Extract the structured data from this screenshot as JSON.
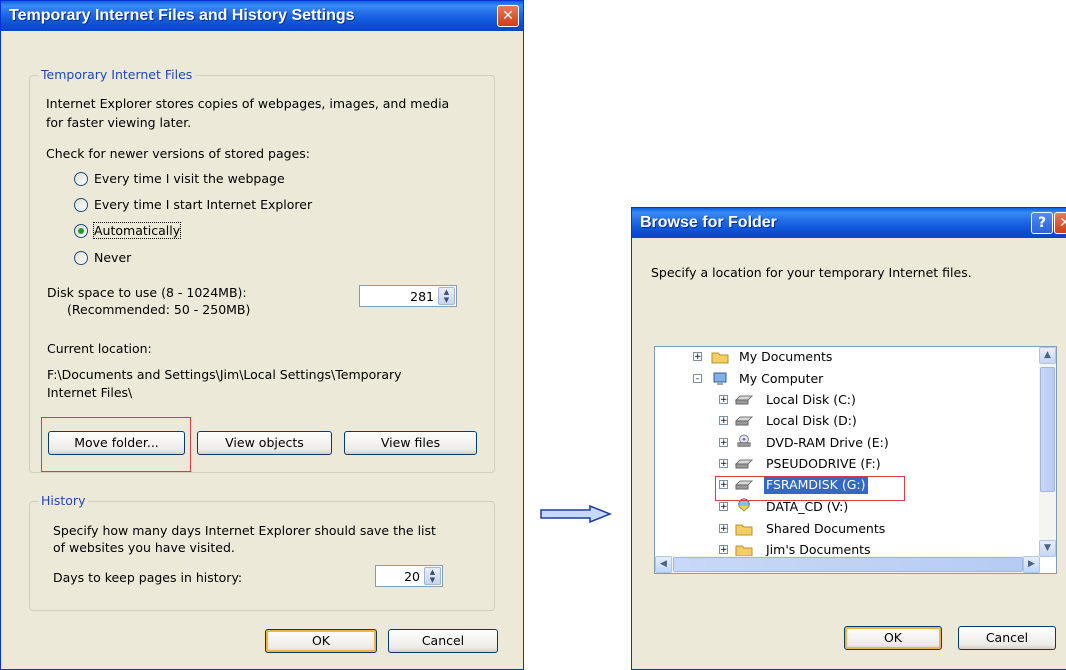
{
  "settings": {
    "title": "Temporary Internet Files and History Settings",
    "tif_legend": "Temporary Internet Files",
    "desc_line1": "Internet Explorer stores copies of webpages, images, and media",
    "desc_line2": "for faster viewing later.",
    "check_label": "Check for newer versions of stored pages:",
    "radios": [
      {
        "label": "Every time I visit the webpage",
        "selected": false
      },
      {
        "label": "Every time I start Internet Explorer",
        "selected": false
      },
      {
        "label": "Automatically",
        "selected": true
      },
      {
        "label": "Never",
        "selected": false
      }
    ],
    "disk_label": "Disk space to use (8 - 1024MB):",
    "disk_rec": "(Recommended: 50 - 250MB)",
    "disk_value": "281",
    "current_label": "Current location:",
    "path_line1": "F:\\Documents and Settings\\Jim\\Local Settings\\Temporary",
    "path_line2": "Internet Files\\",
    "btn_move": "Move folder...",
    "btn_objects": "View objects",
    "btn_files": "View files",
    "history_legend": "History",
    "hist_line1": "Specify how many days Internet Explorer should save the list",
    "hist_line2": "of websites you have visited.",
    "days_label": "Days to keep pages in history:",
    "days_value": "20",
    "ok": "OK",
    "cancel": "Cancel"
  },
  "browse": {
    "title": "Browse for Folder",
    "help_glyph": "?",
    "prompt": "Specify a location for your temporary Internet files.",
    "tree": [
      {
        "label": "My Documents",
        "icon": "folder-icon",
        "expander": "+"
      },
      {
        "label": "My Computer",
        "icon": "computer-icon",
        "expander": "-"
      },
      {
        "label": "Local Disk (C:)",
        "icon": "drive-icon",
        "expander": "+"
      },
      {
        "label": "Local Disk (D:)",
        "icon": "drive-icon",
        "expander": "+"
      },
      {
        "label": "DVD-RAM Drive (E:)",
        "icon": "dvd-icon",
        "expander": "+"
      },
      {
        "label": "PSEUDODRIVE (F:)",
        "icon": "drive-icon",
        "expander": "+"
      },
      {
        "label": "FSRAMDISK (G:)",
        "icon": "drive-icon",
        "expander": "+",
        "selected": true
      },
      {
        "label": "DATA_CD (V:)",
        "icon": "cd-icon",
        "expander": "+"
      },
      {
        "label": "Shared Documents",
        "icon": "folder-icon",
        "expander": "+"
      },
      {
        "label": "Jim's Documents",
        "icon": "folder-icon",
        "expander": "+"
      }
    ],
    "ok": "OK",
    "cancel": "Cancel"
  },
  "colors": {
    "titlebar": "#0a4fd0",
    "window_bg": "#ece9d8",
    "selection": "#316ac5",
    "highlight_box": "#e03a3a"
  }
}
